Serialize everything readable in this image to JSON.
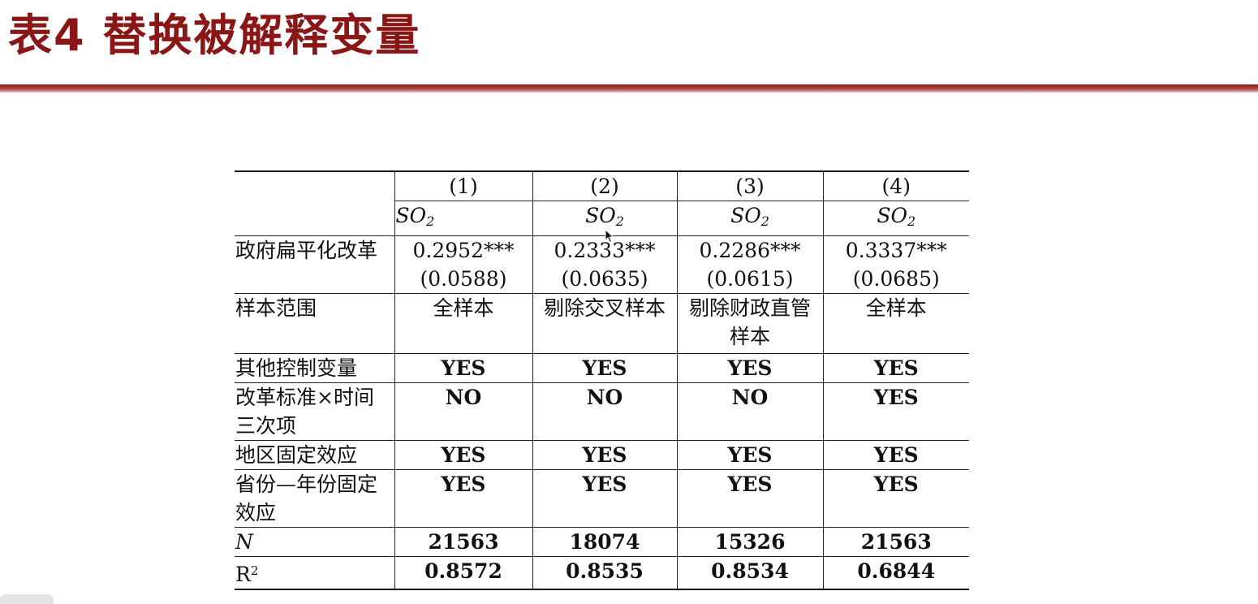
{
  "title": "表4   替换被解释变量",
  "table": {
    "columns": [
      "(1)",
      "(2)",
      "(3)",
      "(4)"
    ],
    "dep_var": {
      "base": "SO",
      "sub": "2"
    },
    "coef_row": {
      "label": "政府扁平化改革",
      "coefs": [
        "0.2952***",
        "0.2333***",
        "0.2286***",
        "0.3337***"
      ],
      "ses": [
        "(0.0588)",
        "(0.0635)",
        "(0.0615)",
        "(0.0685)"
      ]
    },
    "sample_row": {
      "label": "样本范围",
      "values": [
        "全样本",
        "剔除交叉样本",
        "剔除财政直管样本",
        "全样本"
      ]
    },
    "control_rows": [
      {
        "label": "其他控制变量",
        "values": [
          "YES",
          "YES",
          "YES",
          "YES"
        ]
      },
      {
        "label": "改革标准×时间三次项",
        "values": [
          "NO",
          "NO",
          "NO",
          "YES"
        ]
      },
      {
        "label": "地区固定效应",
        "values": [
          "YES",
          "YES",
          "YES",
          "YES"
        ]
      },
      {
        "label": "省份—年份固定效应",
        "values": [
          "YES",
          "YES",
          "YES",
          "YES"
        ]
      }
    ],
    "n_row": {
      "label": "N",
      "values": [
        "21563",
        "18074",
        "15326",
        "21563"
      ]
    },
    "r2_row": {
      "label_base": "R",
      "label_sup": "2",
      "values": [
        "0.8572",
        "0.8535",
        "0.8534",
        "0.6844"
      ]
    }
  },
  "colors": {
    "title": "#8b1616",
    "rule": "#8d1e1e"
  },
  "icons": [
    "mouse-cursor-icon"
  ]
}
